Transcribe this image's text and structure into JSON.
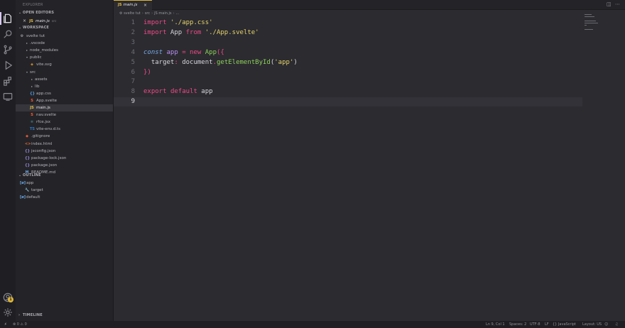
{
  "sidebar": {
    "title": "EXPLORER",
    "open_editors_label": "OPEN EDITORS",
    "open_editor": {
      "icon": "JS",
      "name": "main.js",
      "hint": "src"
    },
    "workspace_label": "WORKSPACE",
    "tree": [
      {
        "name": "svelte tut",
        "icon": "repo",
        "depth": 0
      },
      {
        "name": ".vscode",
        "arrow": "▸",
        "depth": 1
      },
      {
        "name": "node_modules",
        "arrow": "▸",
        "depth": 1
      },
      {
        "name": "public",
        "arrow": "▾",
        "depth": 1
      },
      {
        "name": "vite.svg",
        "icon": "svg",
        "depth": 2
      },
      {
        "name": "src",
        "arrow": "▾",
        "depth": 1
      },
      {
        "name": "assets",
        "arrow": "▸",
        "depth": 2
      },
      {
        "name": "lib",
        "arrow": "▸",
        "depth": 2
      },
      {
        "name": "app.css",
        "icon": "css",
        "depth": 2
      },
      {
        "name": "App.svelte",
        "icon": "svelte",
        "depth": 2
      },
      {
        "name": "main.js",
        "icon": "js",
        "depth": 2,
        "selected": true
      },
      {
        "name": "nav.svelte",
        "icon": "svelte",
        "depth": 2
      },
      {
        "name": "rfce.jsx",
        "icon": "react",
        "depth": 2
      },
      {
        "name": "vite-env.d.ts",
        "icon": "ts",
        "depth": 2
      },
      {
        "name": ".gitignore",
        "icon": "git",
        "depth": 1
      },
      {
        "name": "index.html",
        "icon": "html",
        "depth": 1
      },
      {
        "name": "jsconfig.json",
        "icon": "json",
        "depth": 1
      },
      {
        "name": "package-lock.json",
        "icon": "json",
        "depth": 1
      },
      {
        "name": "package.json",
        "icon": "json",
        "depth": 1
      },
      {
        "name": "README.md",
        "icon": "md",
        "depth": 1
      }
    ],
    "outline_label": "OUTLINE",
    "outline": [
      {
        "name": "app",
        "icon": "[ø]",
        "depth": 0
      },
      {
        "name": "target",
        "icon": "prop",
        "depth": 1
      },
      {
        "name": "default",
        "icon": "[ø]",
        "depth": 0
      }
    ],
    "timeline_label": "TIMELINE"
  },
  "tab": {
    "icon": "JS",
    "label": "main.js"
  },
  "breadcrumb": [
    "svelte tut",
    "src",
    "JS main.js",
    "..."
  ],
  "editor": {
    "lines": [
      {
        "n": "1",
        "tokens": [
          [
            "kw",
            "import"
          ],
          [
            "plain",
            " "
          ],
          [
            "str",
            "'./app.css'"
          ]
        ]
      },
      {
        "n": "2",
        "tokens": [
          [
            "kw",
            "import"
          ],
          [
            "plain",
            " App "
          ],
          [
            "kw",
            "from"
          ],
          [
            "plain",
            " "
          ],
          [
            "str",
            "'./App.svelte'"
          ]
        ]
      },
      {
        "n": "3",
        "tokens": []
      },
      {
        "n": "4",
        "tokens": [
          [
            "kwi",
            "const"
          ],
          [
            "plain",
            " "
          ],
          [
            "var",
            "app"
          ],
          [
            "plain",
            " "
          ],
          [
            "op",
            "="
          ],
          [
            "plain",
            " "
          ],
          [
            "kw",
            "new"
          ],
          [
            "plain",
            " "
          ],
          [
            "cls",
            "App"
          ],
          [
            "br",
            "({"
          ]
        ]
      },
      {
        "n": "5",
        "tokens": [
          [
            "plain",
            "  target"
          ],
          [
            "op",
            ":"
          ],
          [
            "plain",
            " document"
          ],
          [
            "op",
            "."
          ],
          [
            "fn",
            "getElementById"
          ],
          [
            "plain",
            "("
          ],
          [
            "str",
            "'app'"
          ],
          [
            "plain",
            ")"
          ]
        ]
      },
      {
        "n": "6",
        "tokens": [
          [
            "br",
            "})"
          ]
        ]
      },
      {
        "n": "7",
        "tokens": []
      },
      {
        "n": "8",
        "tokens": [
          [
            "kw",
            "export"
          ],
          [
            "plain",
            " "
          ],
          [
            "kw",
            "default"
          ],
          [
            "plain",
            " app"
          ]
        ]
      },
      {
        "n": "9",
        "tokens": [],
        "current": true
      }
    ]
  },
  "status": {
    "left": [
      "⊗ 0 ⚠ 0"
    ],
    "cursor": "Ln 9, Col 1",
    "spaces": "Spaces: 2",
    "encoding": "UTF-8",
    "eol": "LF",
    "language": "{} JavaScript",
    "layout": "Layout: US"
  },
  "colors": {
    "accent": "#e0b63a",
    "background": "#2b2b30",
    "sidebar": "#242428",
    "activity": "#1f1f23"
  }
}
